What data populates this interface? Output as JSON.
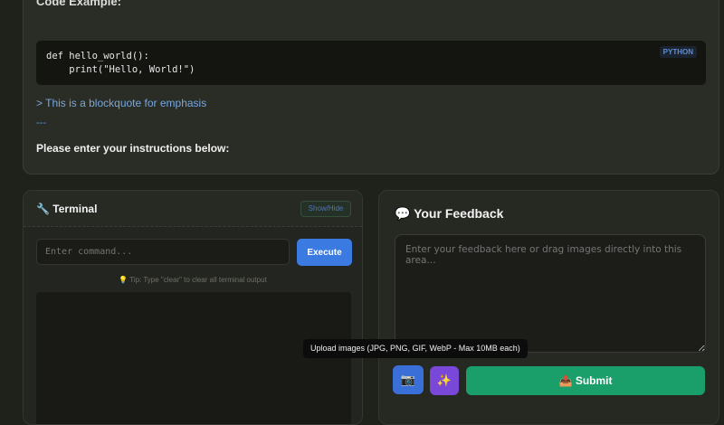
{
  "content": {
    "code_heading": "Code Example:",
    "code_lines": [
      "def hello_world():",
      "    print(\"Hello, World!\")"
    ],
    "code_language": "PYTHON",
    "blockquote": "> This is a blockquote for emphasis",
    "hr": "---",
    "instructions": "Please enter your instructions below:"
  },
  "terminal": {
    "icon": "🔧",
    "title": "Terminal",
    "toggle_label": "Show/Hide",
    "command_placeholder": "Enter command...",
    "execute_label": "Execute",
    "tip": "💡 Tip: Type \"clear\" to clear all terminal output"
  },
  "feedback": {
    "icon": "💬",
    "title": "Your Feedback",
    "placeholder": "Enter your feedback here or drag images directly into this area...",
    "upload_icon": "📷",
    "magic_icon": "✨",
    "submit_icon": "📤",
    "submit_label": "Submit",
    "tooltip": "Upload images (JPG, PNG, GIF, WebP - Max 10MB each)"
  }
}
